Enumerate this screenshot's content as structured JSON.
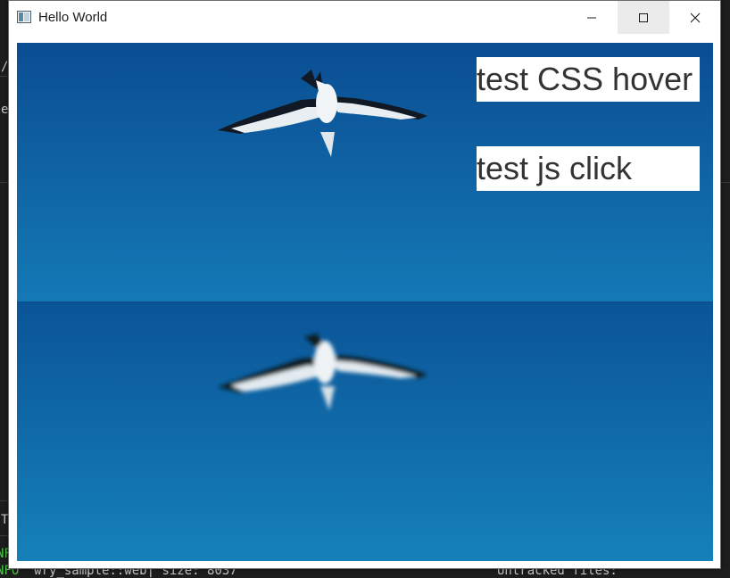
{
  "window": {
    "title": "Hello World",
    "controls": {
      "minimize": "minimize",
      "maximize": "maximize",
      "close": "close"
    }
  },
  "content": {
    "buttons": {
      "hover": "test CSS hover",
      "click": "test js click"
    }
  },
  "background_terminal": {
    "left_fragments": [
      "/",
      "e",
      "T",
      "NF"
    ],
    "status_line_left": "NFO  wry_sample::web| size: 8037",
    "status_line_right": "Untracked files:"
  },
  "colors": {
    "sky_top": "#0a4f93",
    "sky_bottom": "#157fb8",
    "button_bg": "#ffffff",
    "button_text": "#333333"
  }
}
